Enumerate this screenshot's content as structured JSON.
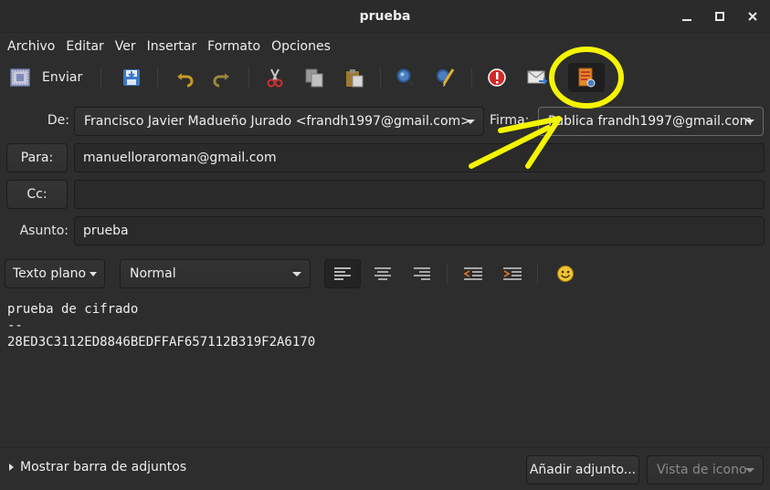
{
  "window": {
    "title": "prueba",
    "minimize_icon": "minimize-icon",
    "maximize_icon": "maximize-icon",
    "close_icon": "close-icon"
  },
  "menubar": {
    "items": [
      "Archivo",
      "Editar",
      "Ver",
      "Insertar",
      "Formato",
      "Opciones"
    ]
  },
  "toolbar": {
    "send_label": "Enviar",
    "icons": [
      "send-icon",
      "save-icon",
      "undo-icon",
      "redo-icon",
      "cut-icon",
      "copy-icon",
      "paste-icon",
      "find-icon",
      "spellcheck-icon",
      "priority-icon",
      "request-receipt-icon",
      "sign-key-icon"
    ]
  },
  "header": {
    "from_label": "De:",
    "from_value": "Francisco Javier Madueño Jurado <frandh1997@gmail.com>",
    "signature_label": "Firma:",
    "signature_value": "Publica frandh1997@gmail.com",
    "to_label": "Para:",
    "to_value": "manuelloraroman@gmail.com",
    "cc_label": "Cc:",
    "cc_value": "",
    "subject_label": "Asunto:",
    "subject_value": "prueba"
  },
  "format_toolbar": {
    "text_mode": "Texto plano",
    "paragraph_style": "Normal",
    "align_left_icon": "align-left-icon",
    "align_center_icon": "align-center-icon",
    "align_right_icon": "align-right-icon",
    "unindent_icon": "unindent-icon",
    "indent_icon": "indent-icon",
    "emoticon_icon": "emoticon-icon"
  },
  "body": {
    "lines": [
      "prueba de cifrado",
      "--",
      "28ED3C3112ED8846BEDFFAF657112B319F2A6170"
    ]
  },
  "attachments": {
    "toggle_label": "Mostrar barra de adjuntos",
    "add_button": "Añadir adjunto...",
    "view_mode": "Vista de icono"
  },
  "annotation": {
    "color": "#f5f500"
  },
  "colors": {
    "background": "#2d2d2d",
    "entry_bg": "#2a2a2a",
    "text": "#eeeeee",
    "priority_red": "#d52828"
  }
}
